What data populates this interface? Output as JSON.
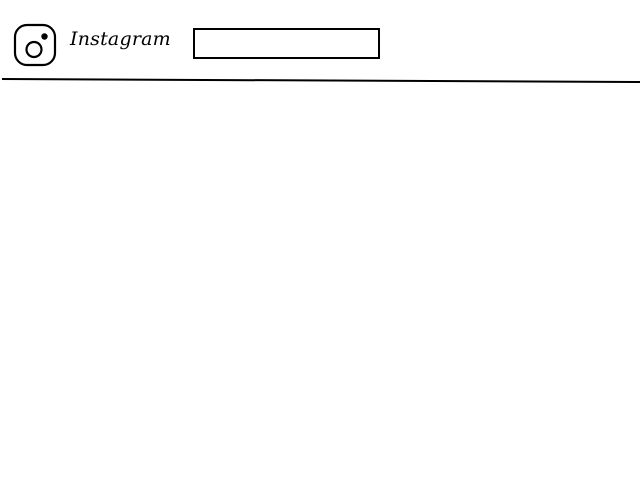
{
  "header": {
    "logo_icon": "instagram-camera-icon",
    "brand_name": "Instagram",
    "search": {
      "value": "",
      "placeholder": ""
    }
  },
  "colors": {
    "background": "#ffffff",
    "foreground": "#000000"
  }
}
